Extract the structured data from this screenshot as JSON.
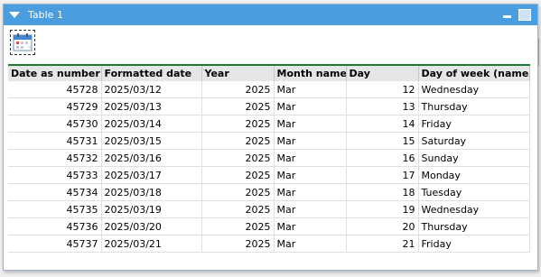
{
  "window": {
    "title": "Table 1"
  },
  "toolbar": {
    "calendar_icon": "calendar-icon"
  },
  "table": {
    "headers": [
      "Date as number",
      "Formatted date",
      "Year",
      "Month name",
      "Day",
      "Day of week (name)"
    ],
    "rows": [
      [
        "45728",
        "2025/03/12",
        "2025",
        "Mar",
        "12",
        "Wednesday"
      ],
      [
        "45729",
        "2025/03/13",
        "2025",
        "Mar",
        "13",
        "Thursday"
      ],
      [
        "45730",
        "2025/03/14",
        "2025",
        "Mar",
        "14",
        "Friday"
      ],
      [
        "45731",
        "2025/03/15",
        "2025",
        "Mar",
        "15",
        "Saturday"
      ],
      [
        "45732",
        "2025/03/16",
        "2025",
        "Mar",
        "16",
        "Sunday"
      ],
      [
        "45733",
        "2025/03/17",
        "2025",
        "Mar",
        "17",
        "Monday"
      ],
      [
        "45734",
        "2025/03/18",
        "2025",
        "Mar",
        "18",
        "Tuesday"
      ],
      [
        "45735",
        "2025/03/19",
        "2025",
        "Mar",
        "19",
        "Wednesday"
      ],
      [
        "45736",
        "2025/03/20",
        "2025",
        "Mar",
        "20",
        "Thursday"
      ],
      [
        "45737",
        "2025/03/21",
        "2025",
        "Mar",
        "21",
        "Friday"
      ]
    ]
  },
  "colors": {
    "titlebar": "#4a9ee0",
    "header_border": "#1b7d2f"
  }
}
